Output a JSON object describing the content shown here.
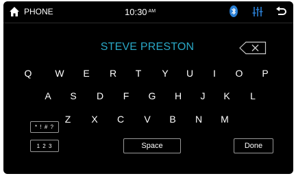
{
  "status_bar": {
    "source_label": "PHONE",
    "time": "10:30",
    "ampm": "AM",
    "icons": [
      "home-icon",
      "bluetooth-icon",
      "equalizer-icon",
      "back-icon"
    ]
  },
  "entry": {
    "text": "STEVE PRESTON"
  },
  "keyboard": {
    "row1": [
      "Q",
      "W",
      "E",
      "R",
      "T",
      "Y",
      "U",
      "I",
      "O",
      "P"
    ],
    "row2": [
      "A",
      "S",
      "D",
      "F",
      "G",
      "H",
      "J",
      "K",
      "L"
    ],
    "row3": [
      "Z",
      "X",
      "C",
      "V",
      "B",
      "N",
      "M"
    ],
    "symbols_label": "* ! # ?",
    "numbers_label": "1 2 3",
    "space_label": "Space",
    "done_label": "Done"
  },
  "colors": {
    "accent": "#2aa8c6",
    "bluetooth": "#2a7fd4",
    "background": "#000000"
  }
}
